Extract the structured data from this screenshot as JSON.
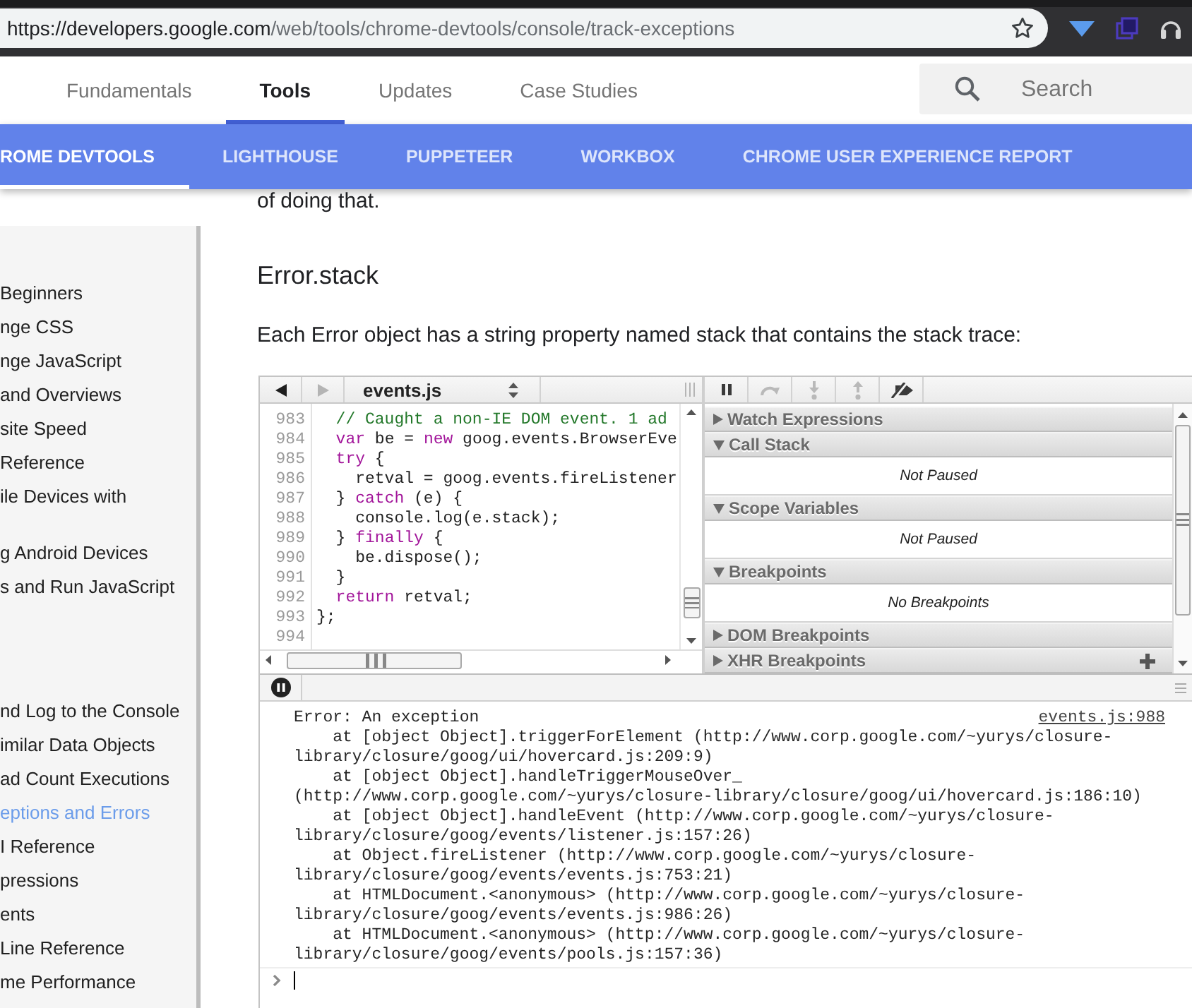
{
  "browser": {
    "url_host": "https://developers.google.com",
    "url_path": "/web/tools/chrome-devtools/console/track-exceptions"
  },
  "header": {
    "tabs": [
      {
        "label": "Fundamentals",
        "selected": false
      },
      {
        "label": "Tools",
        "selected": true
      },
      {
        "label": "Updates",
        "selected": false
      },
      {
        "label": "Case Studies",
        "selected": false
      }
    ],
    "search": {
      "placeholder": "Search"
    }
  },
  "nav_bar": {
    "items": [
      {
        "label": "ROME DEVTOOLS",
        "selected": true
      },
      {
        "label": "LIGHTHOUSE",
        "selected": false
      },
      {
        "label": "PUPPETEER",
        "selected": false
      },
      {
        "label": "WORKBOX",
        "selected": false
      },
      {
        "label": "CHROME USER EXPERIENCE REPORT",
        "selected": false
      }
    ]
  },
  "sidebar": {
    "groups": [
      {
        "items": [
          {
            "label": "Beginners",
            "selected": false
          },
          {
            "label": "nge CSS",
            "selected": false
          },
          {
            "label": "nge JavaScript",
            "selected": false
          },
          {
            "label": "and Overviews",
            "selected": false
          },
          {
            "label": "site Speed",
            "selected": false
          },
          {
            "label": "Reference",
            "selected": false
          },
          {
            "label": "ile Devices with",
            "selected": false
          }
        ]
      },
      {
        "items": [
          {
            "label": "g Android Devices",
            "selected": false
          },
          {
            "label": "s and Run JavaScript",
            "selected": false
          }
        ]
      },
      {
        "items": [
          {
            "label": "nd Log to the Console",
            "selected": false
          },
          {
            "label": "imilar Data Objects",
            "selected": false
          },
          {
            "label": "ad Count Executions",
            "selected": false
          },
          {
            "label": "eptions and Errors",
            "selected": true
          },
          {
            "label": "I Reference",
            "selected": false
          },
          {
            "label": "pressions",
            "selected": false
          },
          {
            "label": "ents",
            "selected": false
          },
          {
            "label": "Line Reference",
            "selected": false
          },
          {
            "label": "me Performance",
            "selected": false
          }
        ]
      }
    ]
  },
  "article": {
    "cut_line": "of doing that.",
    "heading": "Error.stack",
    "paragraph": "Each Error object has a string property named stack that contains the stack trace:"
  },
  "devtools": {
    "nav_buttons": [
      {
        "kind": "back",
        "disabled": false
      },
      {
        "kind": "forward",
        "disabled": true
      }
    ],
    "file_select": "events.js",
    "debug_buttons": [
      {
        "kind": "pause",
        "disabled": false
      },
      {
        "kind": "step-over",
        "disabled": true
      },
      {
        "kind": "step-into",
        "disabled": true
      },
      {
        "kind": "step-out",
        "disabled": true
      },
      {
        "kind": "deactivate-breakpoints",
        "disabled": false
      }
    ],
    "code_lines": [
      {
        "number": "983",
        "tokens": [
          {
            "kind": "comment",
            "text": "  // Caught a non-IE DOM event. 1 ad"
          }
        ]
      },
      {
        "number": "984",
        "tokens": [
          {
            "kind": "keyword",
            "text": "  var"
          },
          {
            "kind": "plain",
            "text": " be = "
          },
          {
            "kind": "keyword",
            "text": "new"
          },
          {
            "kind": "plain",
            "text": " goog.events.BrowserEve"
          }
        ]
      },
      {
        "number": "985",
        "tokens": [
          {
            "kind": "keyword",
            "text": "  try"
          },
          {
            "kind": "plain",
            "text": " {"
          }
        ]
      },
      {
        "number": "986",
        "tokens": [
          {
            "kind": "plain",
            "text": "    retval = goog.events.fireListener"
          }
        ]
      },
      {
        "number": "987",
        "tokens": [
          {
            "kind": "plain",
            "text": "  } "
          },
          {
            "kind": "keyword",
            "text": "catch"
          },
          {
            "kind": "plain",
            "text": " (e) {"
          }
        ]
      },
      {
        "number": "988",
        "tokens": [
          {
            "kind": "plain",
            "text": "    console.log(e.stack);"
          }
        ]
      },
      {
        "number": "989",
        "tokens": [
          {
            "kind": "plain",
            "text": "  } "
          },
          {
            "kind": "keyword",
            "text": "finally"
          },
          {
            "kind": "plain",
            "text": " {"
          }
        ]
      },
      {
        "number": "990",
        "tokens": [
          {
            "kind": "plain",
            "text": "    be.dispose();"
          }
        ]
      },
      {
        "number": "991",
        "tokens": [
          {
            "kind": "plain",
            "text": "  }"
          }
        ]
      },
      {
        "number": "992",
        "tokens": [
          {
            "kind": "keyword",
            "text": "  return"
          },
          {
            "kind": "plain",
            "text": " retval;"
          }
        ]
      },
      {
        "number": "993",
        "tokens": [
          {
            "kind": "plain",
            "text": "};"
          }
        ]
      },
      {
        "number": "994"
      }
    ],
    "sections": [
      {
        "title": "Watch Expressions",
        "expanded": false,
        "add_button": false
      },
      {
        "title": "Call Stack",
        "expanded": true,
        "body": "Not Paused",
        "add_button": false
      },
      {
        "title": "Scope Variables",
        "expanded": true,
        "body": "Not Paused",
        "add_button": false
      },
      {
        "title": "Breakpoints",
        "expanded": true,
        "body": "No Breakpoints",
        "add_button": false
      },
      {
        "title": "DOM Breakpoints",
        "expanded": false,
        "add_button": false
      },
      {
        "title": "XHR Breakpoints",
        "expanded": false,
        "add_button": true
      }
    ],
    "console": {
      "message": "Error: An exception",
      "source_link": "events.js:988",
      "frames": [
        {
          "lines": [
            "at [object Object].triggerForElement (http://www.corp.google.com/~yurys/closure-",
            "library/closure/goog/ui/hovercard.js:209:9)"
          ]
        },
        {
          "lines": [
            "at [object Object].handleTriggerMouseOver_",
            "(http://www.corp.google.com/~yurys/closure-library/closure/goog/ui/hovercard.js:186:10)"
          ]
        },
        {
          "lines": [
            "at [object Object].handleEvent (http://www.corp.google.com/~yurys/closure-",
            "library/closure/goog/events/listener.js:157:26)"
          ]
        },
        {
          "lines": [
            "at Object.fireListener (http://www.corp.google.com/~yurys/closure-",
            "library/closure/goog/events/events.js:753:21)"
          ]
        },
        {
          "lines": [
            "at HTMLDocument.<anonymous> (http://www.corp.google.com/~yurys/closure-",
            "library/closure/goog/events/events.js:986:26)"
          ]
        },
        {
          "lines": [
            "at HTMLDocument.<anonymous> (http://www.corp.google.com/~yurys/closure-",
            "library/closure/goog/events/pools.js:157:36)"
          ]
        }
      ]
    }
  }
}
